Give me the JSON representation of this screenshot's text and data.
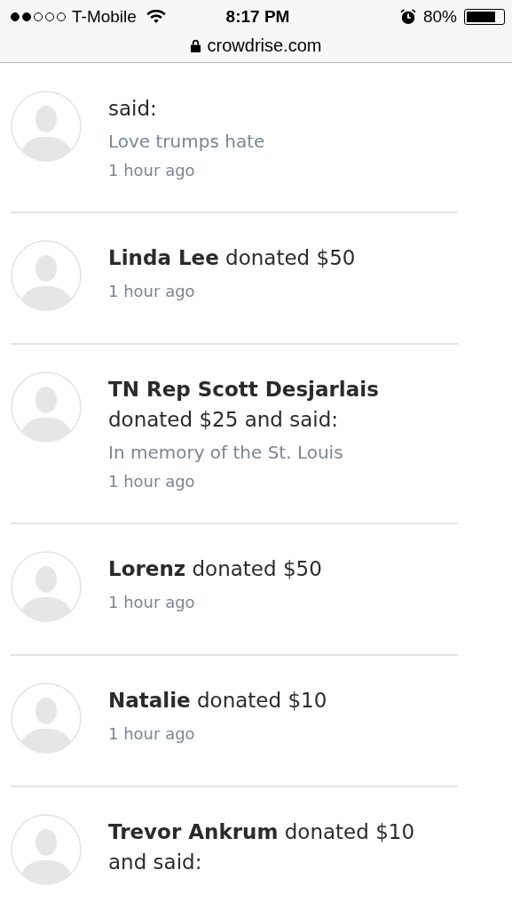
{
  "status_bar": {
    "signal_dots": [
      {
        "filled": true
      },
      {
        "filled": true
      },
      {
        "filled": false
      },
      {
        "filled": false
      },
      {
        "filled": false
      }
    ],
    "carrier": "T-Mobile",
    "time": "8:17 PM",
    "battery": "80%",
    "level": 0.8
  },
  "address_bar": {
    "url": "crowdrise.com"
  },
  "donations": [
    {
      "text": "said:",
      "message": "Love trumps hate",
      "time": "1 hour ago"
    },
    {
      "text": "**Linda Lee** donated $50",
      "time": "1 hour ago"
    },
    {
      "text": "**TN Rep Scott Desjarlais** donated $25 and said:",
      "message": "In memory of the St. Louis",
      "time": "1 hour ago"
    },
    {
      "text": "**Lorenz** donated $50",
      "time": "1 hour ago"
    },
    {
      "text": "**Natalie** donated $10",
      "time": "1 hour ago"
    },
    {
      "text": "**Trevor Ankrum** donated $10 and said:"
    }
  ]
}
